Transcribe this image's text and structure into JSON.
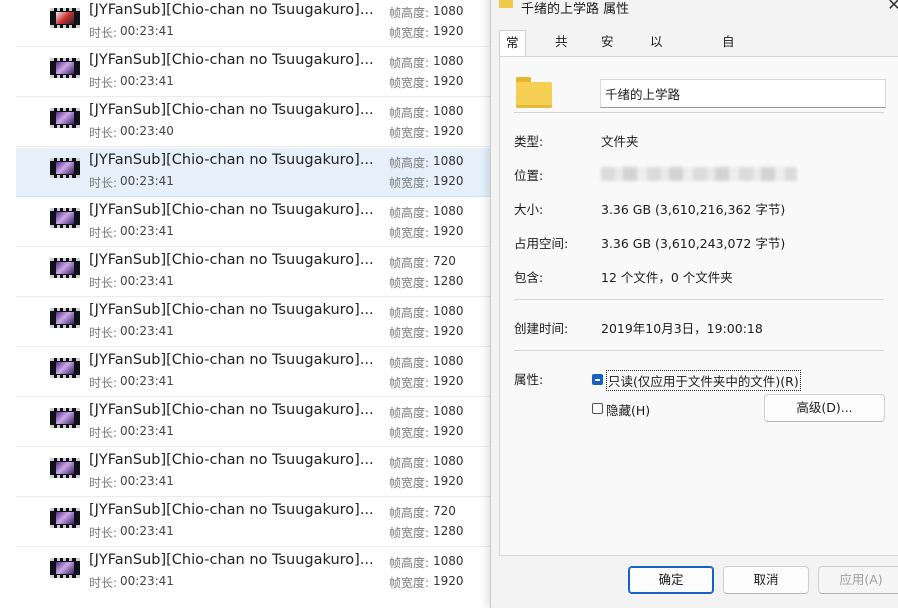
{
  "file_list": {
    "height_label": "帧高度:",
    "width_label": "帧宽度:",
    "duration_label": "时长:",
    "rows": [
      {
        "name": "[JYFanSub][Chio-chan no Tsuugakuro]...",
        "duration": "00:23:41",
        "height": "1080",
        "width": "1920"
      },
      {
        "name": "[JYFanSub][Chio-chan no Tsuugakuro]...",
        "duration": "00:23:41",
        "height": "1080",
        "width": "1920"
      },
      {
        "name": "[JYFanSub][Chio-chan no Tsuugakuro]...",
        "duration": "00:23:40",
        "height": "1080",
        "width": "1920"
      },
      {
        "name": "[JYFanSub][Chio-chan no Tsuugakuro]...",
        "duration": "00:23:41",
        "height": "1080",
        "width": "1920"
      },
      {
        "name": "[JYFanSub][Chio-chan no Tsuugakuro]...",
        "duration": "00:23:41",
        "height": "1080",
        "width": "1920"
      },
      {
        "name": "[JYFanSub][Chio-chan no Tsuugakuro]...",
        "duration": "00:23:41",
        "height": "720",
        "width": "1280"
      },
      {
        "name": "[JYFanSub][Chio-chan no Tsuugakuro]...",
        "duration": "00:23:41",
        "height": "1080",
        "width": "1920"
      },
      {
        "name": "[JYFanSub][Chio-chan no Tsuugakuro]...",
        "duration": "00:23:41",
        "height": "1080",
        "width": "1920"
      },
      {
        "name": "[JYFanSub][Chio-chan no Tsuugakuro]...",
        "duration": "00:23:41",
        "height": "1080",
        "width": "1920"
      },
      {
        "name": "[JYFanSub][Chio-chan no Tsuugakuro]...",
        "duration": "00:23:41",
        "height": "1080",
        "width": "1920"
      },
      {
        "name": "[JYFanSub][Chio-chan no Tsuugakuro]...",
        "duration": "00:23:41",
        "height": "720",
        "width": "1280"
      },
      {
        "name": "[JYFanSub][Chio-chan no Tsuugakuro]...",
        "duration": "00:23:41",
        "height": "1080",
        "width": "1920"
      }
    ],
    "selected_index": 3
  },
  "dialog": {
    "title": "千绪的上学路 属性",
    "close_icon": "close-icon",
    "tabs": [
      "常规",
      "共享",
      "安全",
      "以前的版本",
      "自定义"
    ],
    "active_tab": 0,
    "folder_name": "千绪的上学路",
    "properties": {
      "type_label": "类型:",
      "type_value": "文件夹",
      "location_label": "位置:",
      "size_label": "大小:",
      "size_value": "3.36 GB (3,610,216,362 字节)",
      "disk_label": "占用空间:",
      "disk_value": "3.36 GB (3,610,243,072 字节)",
      "contains_label": "包含:",
      "contains_value": "12 个文件，0 个文件夹",
      "created_label": "创建时间:",
      "created_value": "2019年10月3日，19:00:18",
      "attributes_label": "属性:"
    },
    "attributes": {
      "readonly_label": "只读(仅应用于文件夹中的文件)(R)",
      "hidden_label": "隐藏(H)",
      "advanced_label": "高级(D)..."
    },
    "buttons": {
      "ok": "确定",
      "cancel": "取消",
      "apply": "应用(A)"
    },
    "colors": {
      "accent": "#1662c4",
      "folder": "#f6cf55"
    }
  }
}
